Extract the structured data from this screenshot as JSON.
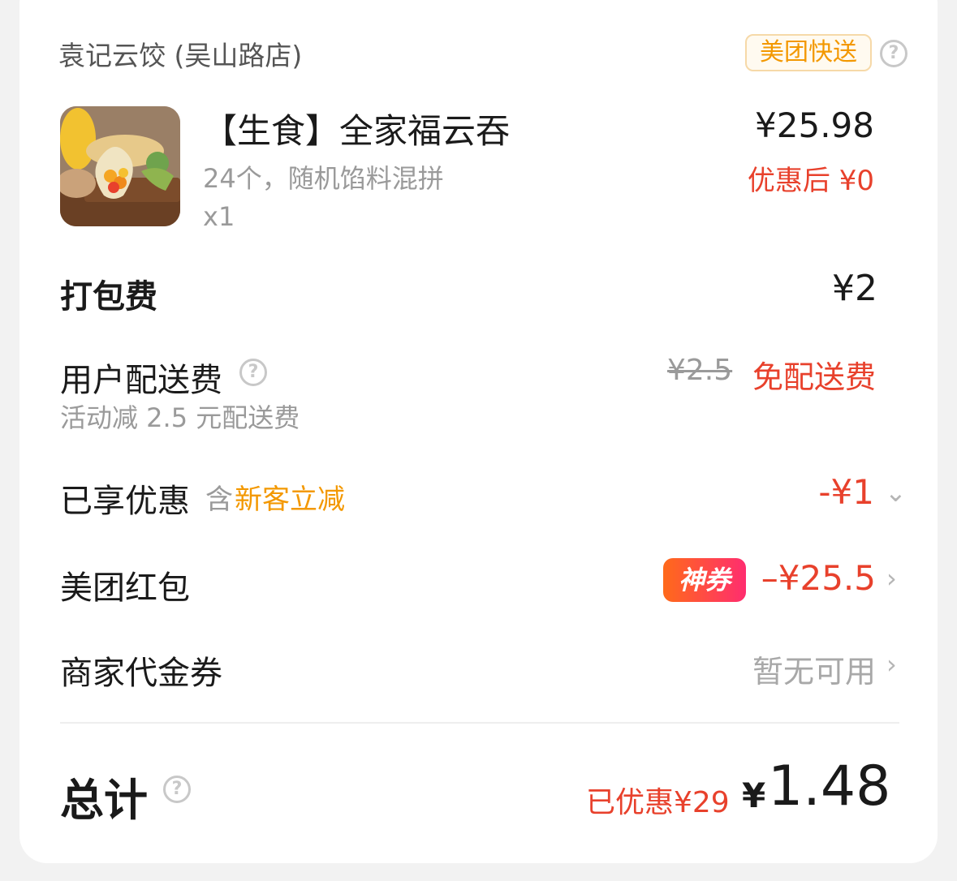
{
  "shop": {
    "name": "袁记云饺 (吴山路店)",
    "delivery_tag": "美团快送",
    "help_icon": "help-circle-icon"
  },
  "item": {
    "name": "【生食】全家福云吞",
    "spec": "24个，随机馅料混拼",
    "qty": "x1",
    "price": "¥25.98",
    "after_discount": "优惠后 ¥0"
  },
  "packaging": {
    "label": "打包费",
    "value": "¥2"
  },
  "delivery": {
    "label": "用户配送费",
    "sub": "活动减 2.5 元配送费",
    "original": "¥2.5",
    "free_label": "免配送费"
  },
  "enjoyed": {
    "label": "已享优惠",
    "prefix": "含",
    "tag": "新客立减",
    "value": "-¥1",
    "chevron": "chevron-down-icon"
  },
  "red_packet": {
    "label": "美团红包",
    "badge": "神券",
    "value": "–¥25.5",
    "chevron": "chevron-right-icon"
  },
  "merchant_coupon": {
    "label": "商家代金券",
    "value": "暂无可用",
    "chevron": "chevron-right-icon"
  },
  "total": {
    "label": "总计",
    "saved": "已优惠¥29",
    "symbol": "¥",
    "value": "1.48"
  },
  "colors": {
    "accent_red": "#e8412c",
    "accent_orange": "#f39800",
    "badge_gradient_start": "#ff6a1a",
    "badge_gradient_end": "#ff2d6f"
  }
}
